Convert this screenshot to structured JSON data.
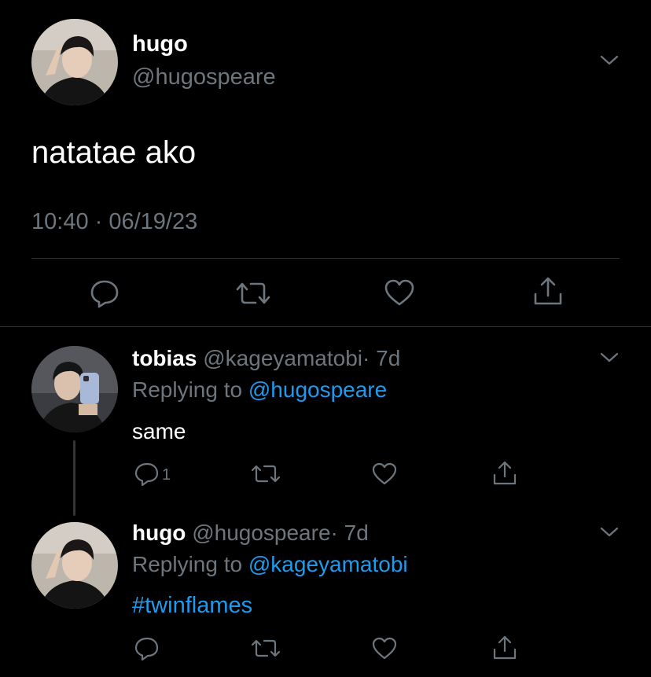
{
  "main_tweet": {
    "display_name": "hugo",
    "handle": "@hugospeare",
    "text": "natatae ako",
    "timestamp": "10:40 · 06/19/23",
    "avatar_icon": "profile-photo"
  },
  "replies": [
    {
      "display_name": "tobias",
      "handle": "@kageyamatobi",
      "time": "· 7d",
      "replying_prefix": "Replying to",
      "replying_to": "@hugospeare",
      "text": "same",
      "reply_count": "1",
      "avatar_icon": "profile-photo"
    },
    {
      "display_name": "hugo",
      "handle": "@hugospeare",
      "time": "· 7d",
      "replying_prefix": "Replying to",
      "replying_to": "@kageyamatobi",
      "text": "#twinflames",
      "reply_count": "",
      "avatar_icon": "profile-photo"
    }
  ],
  "icons": {
    "reply": "reply-icon",
    "retweet": "retweet-icon",
    "like": "heart-icon",
    "share": "share-icon",
    "more": "chevron-down-icon"
  },
  "colors": {
    "background": "#000000",
    "text": "#ffffff",
    "muted": "#6e767d",
    "link": "#1d9bf0",
    "divider": "#2f3336"
  }
}
